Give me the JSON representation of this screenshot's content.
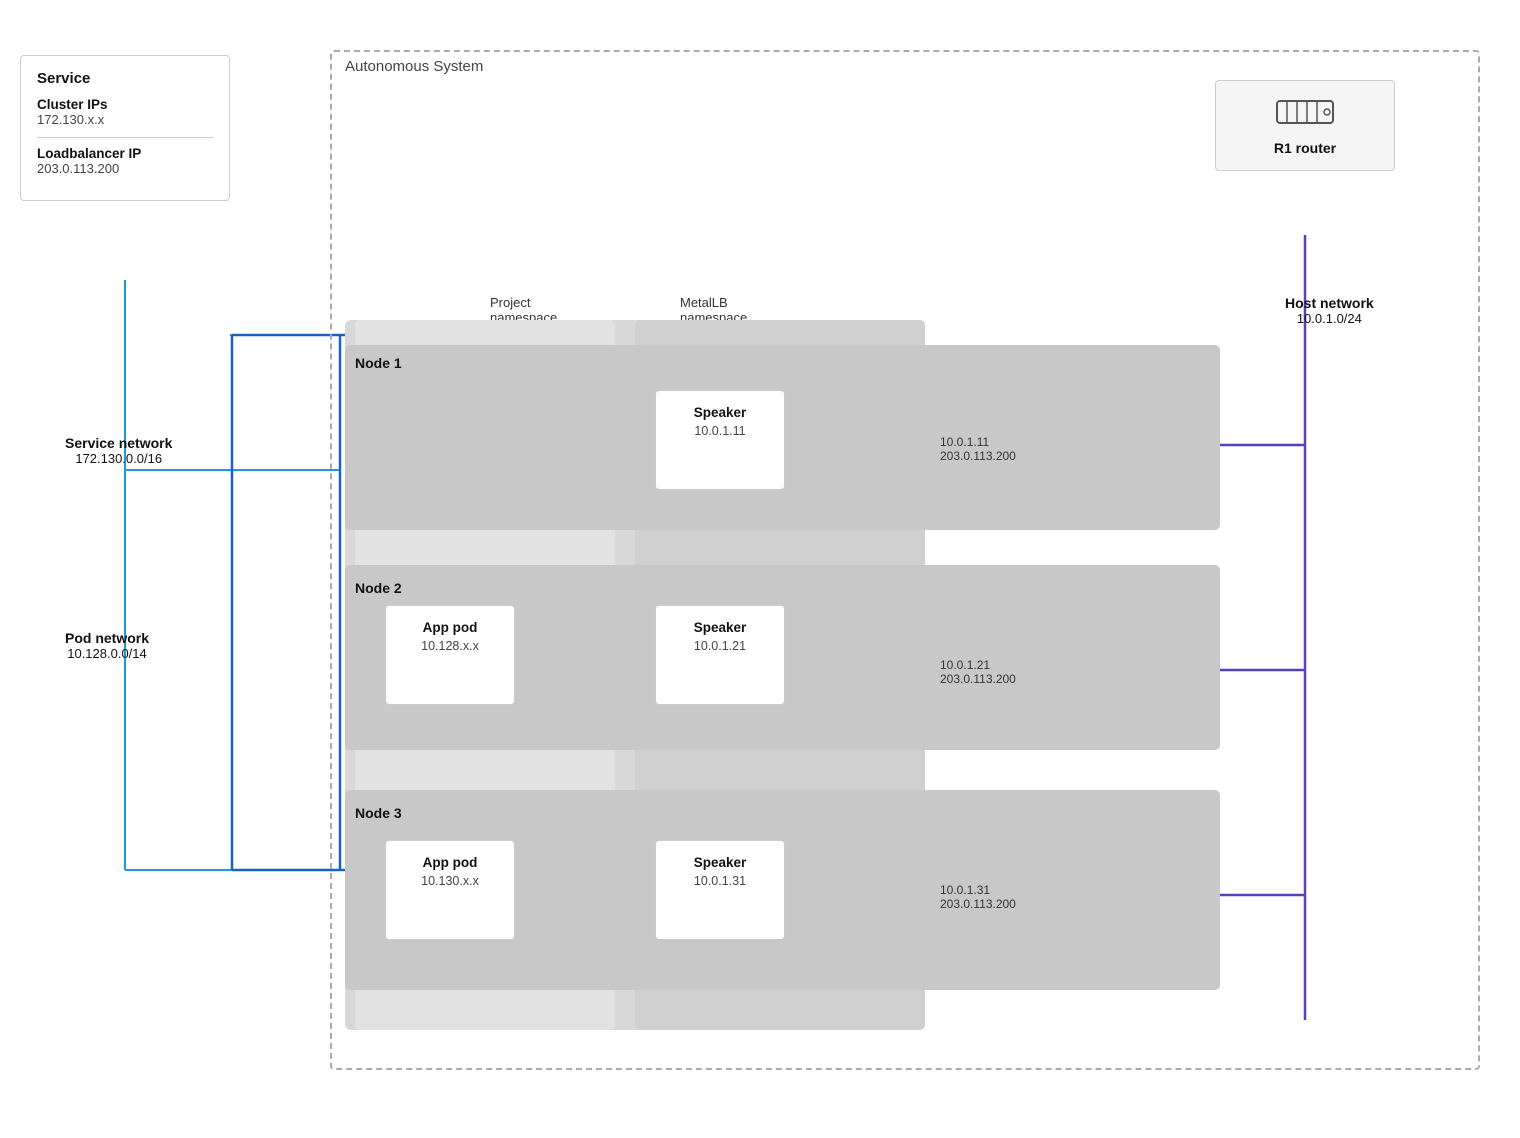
{
  "service_box": {
    "title": "Service",
    "cluster_ips_label": "Cluster IPs",
    "cluster_ips_value": "172.130.x.x",
    "loadbalancer_label": "Loadbalancer IP",
    "loadbalancer_value": "203.0.113.200"
  },
  "autonomous_system": {
    "label": "Autonomous System"
  },
  "router": {
    "label": "R1 router"
  },
  "host_network": {
    "title": "Host network",
    "cidr": "10.0.1.0/24"
  },
  "namespaces": {
    "project": {
      "line1": "Project",
      "line2": "namespace"
    },
    "metallb": {
      "line1": "MetalLB",
      "line2": "namespace"
    }
  },
  "nodes": [
    {
      "label": "Node 1"
    },
    {
      "label": "Node 2"
    },
    {
      "label": "Node 3"
    }
  ],
  "pods": {
    "node1_speaker": {
      "name": "Speaker",
      "ip": "10.0.1.11"
    },
    "node2_app": {
      "name": "App pod",
      "ip": "10.128.x.x"
    },
    "node2_speaker": {
      "name": "Speaker",
      "ip": "10.0.1.21"
    },
    "node3_app": {
      "name": "App pod",
      "ip": "10.130.x.x"
    },
    "node3_speaker": {
      "name": "Speaker",
      "ip": "10.0.1.31"
    }
  },
  "bgp_labels": {
    "node1": {
      "line1": "10.0.1.11",
      "line2": "203.0.113.200"
    },
    "node2": {
      "line1": "10.0.1.21",
      "line2": "203.0.113.200"
    },
    "node3": {
      "line1": "10.0.1.31",
      "line2": "203.0.113.200"
    }
  },
  "service_network": {
    "title": "Service network",
    "cidr": "172.130.0.0/16"
  },
  "pod_network": {
    "title": "Pod network",
    "cidr": "10.128.0.0/14"
  }
}
